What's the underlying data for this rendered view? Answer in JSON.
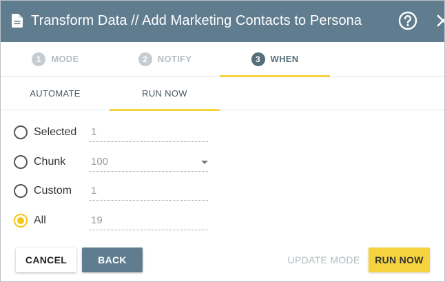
{
  "dialog": {
    "title": "Transform Data // Add Marketing Contacts to Persona",
    "icons": {
      "title": "document-icon",
      "help": "help-circle-icon",
      "close": "close-icon"
    }
  },
  "steps": [
    {
      "number": "1",
      "label": "MODE",
      "active": false
    },
    {
      "number": "2",
      "label": "NOTIFY",
      "active": false
    },
    {
      "number": "3",
      "label": "WHEN",
      "active": true
    }
  ],
  "subtabs": [
    {
      "label": "AUTOMATE",
      "active": false
    },
    {
      "label": "RUN NOW",
      "active": true
    }
  ],
  "run_options": [
    {
      "label": "Selected",
      "value": "1",
      "checked": false
    },
    {
      "label": "Chunk",
      "value": "100",
      "checked": false,
      "is_dropdown": true
    },
    {
      "label": "Custom",
      "value": "1",
      "checked": false
    },
    {
      "label": "All",
      "value": "19",
      "checked": true
    }
  ],
  "buttons": {
    "cancel": "CANCEL",
    "back": "BACK",
    "update_mode": "UPDATE MODE",
    "run_now": "RUN NOW"
  },
  "colors": {
    "header_bg": "#5f7d8f",
    "accent": "#f5d33f",
    "active_step": "#546e7a"
  }
}
